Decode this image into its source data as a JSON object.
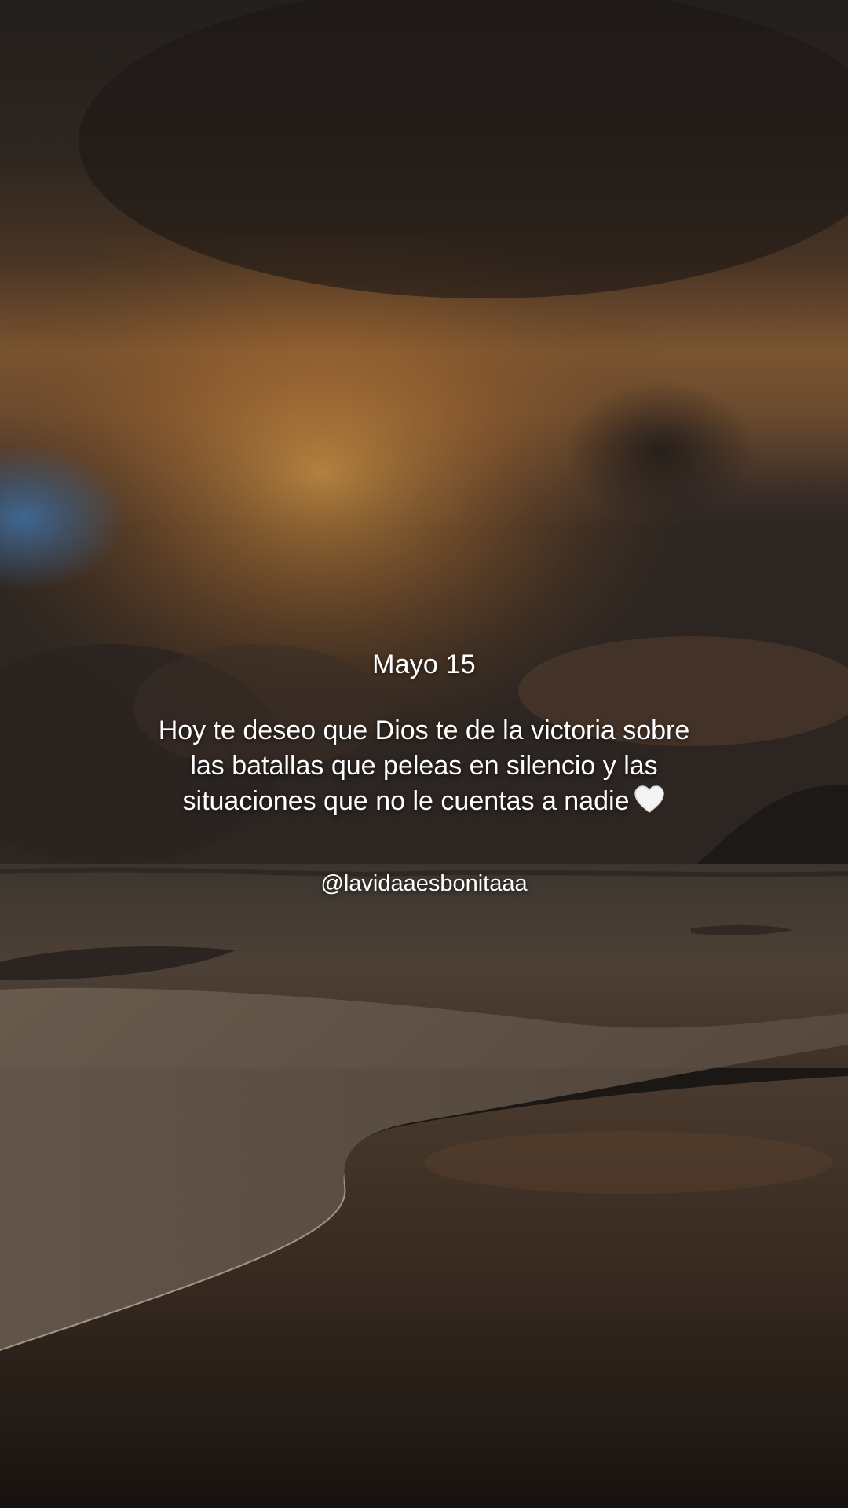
{
  "post": {
    "date": "Mayo 15",
    "quote": "Hoy te deseo que Dios te de la victoria sobre las batallas que peleas en silencio y las situaciones que no le cuentas a nadie",
    "quote_emoji": "white-heart-icon",
    "handle": "@lavidaaesbonitaaa"
  },
  "colors": {
    "text": "#ffffff",
    "sky_dark": "#2b2420",
    "sky_glow": "#c98a3c",
    "sky_blue": "#3d5f86",
    "sand": "#3a2b22"
  }
}
